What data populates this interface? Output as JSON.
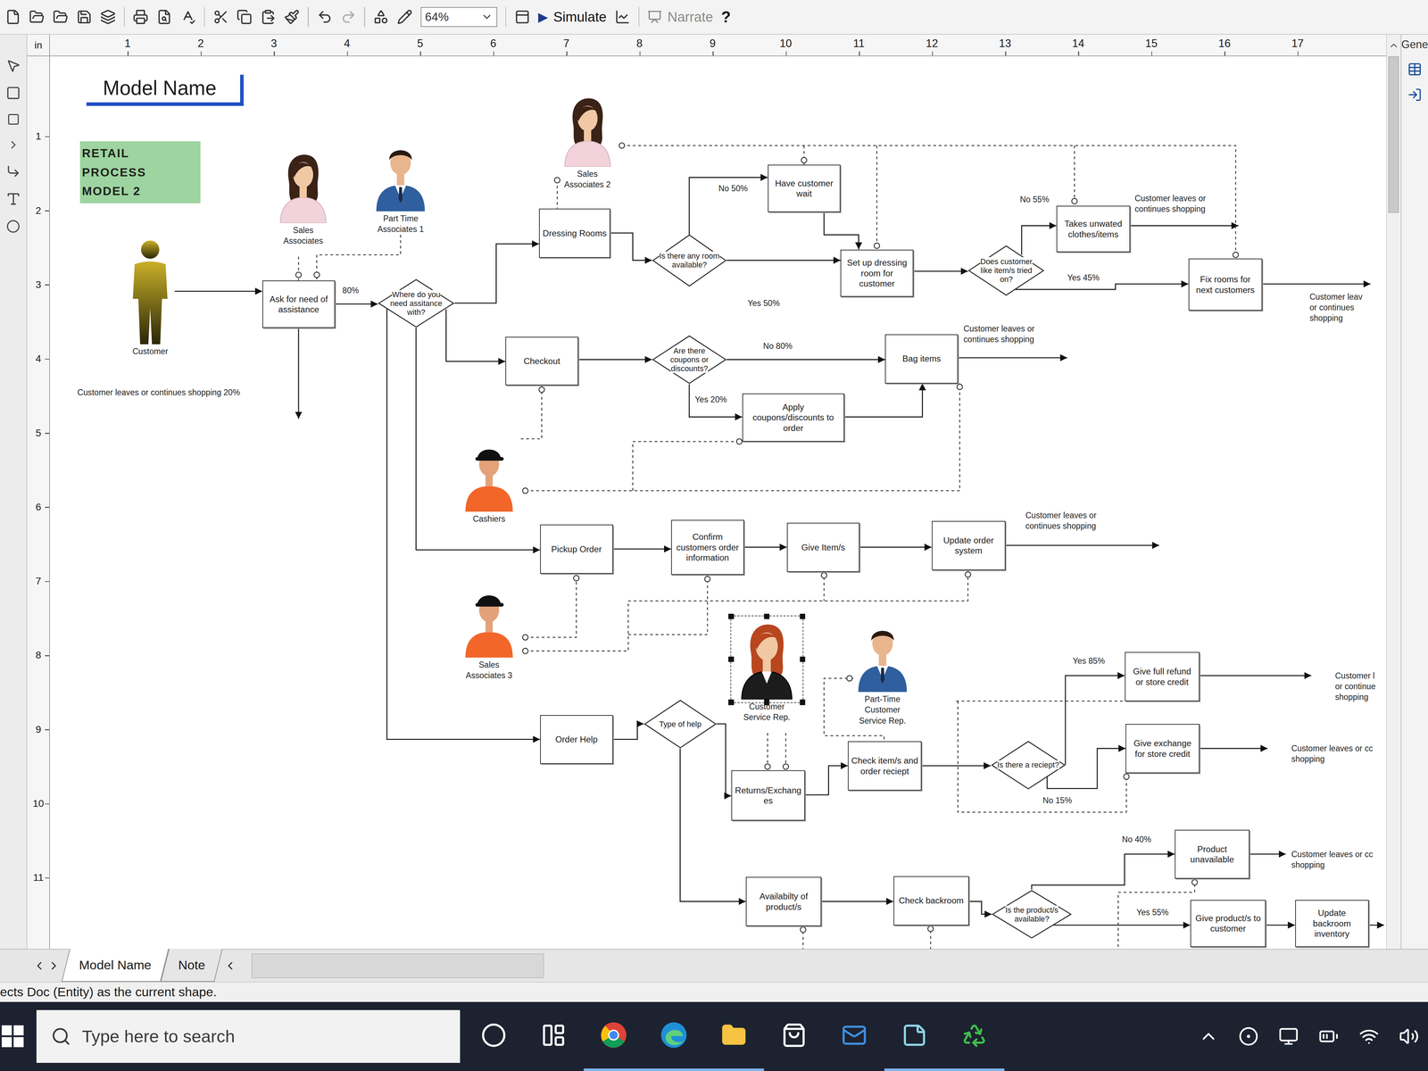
{
  "toolbar": {
    "zoom": "64%",
    "simulate": {
      "icon": "▶",
      "label": "Simulate"
    },
    "narrate": {
      "label": "Narrate",
      "disabled": true
    },
    "help": "?"
  },
  "ruler": {
    "unit": "in",
    "horizontal": [
      "1",
      "2",
      "3",
      "4",
      "5",
      "6",
      "7",
      "8",
      "9",
      "10",
      "11",
      "12",
      "13",
      "14",
      "15",
      "16",
      "17"
    ],
    "vertical": [
      "1",
      "2",
      "3",
      "4",
      "5",
      "6",
      "7",
      "8",
      "9",
      "10",
      "11"
    ]
  },
  "side_panel": {
    "title": "Gene"
  },
  "model": {
    "title": "Model Name",
    "label": [
      "RETAIL",
      "PROCESS",
      "MODEL 2"
    ]
  },
  "resources": [
    {
      "lines": [
        "Sales",
        "Associates"
      ],
      "kind": "woman",
      "color": "#f2d3dc",
      "selected": false
    },
    {
      "lines": [
        "Part Time",
        "Associates 1"
      ],
      "kind": "man",
      "color": "#2f5f9e",
      "selected": false
    },
    {
      "lines": [
        "Sales",
        "Associates 2"
      ],
      "kind": "woman",
      "color": "#f2d3dc",
      "selected": false
    },
    {
      "lines": [
        "Customer"
      ],
      "kind": "customer",
      "color": "#c9b028",
      "selected": false
    },
    {
      "lines": [
        "Cashiers"
      ],
      "kind": "worker",
      "color": "#f2662a",
      "selected": false
    },
    {
      "lines": [
        "Sales",
        "Associates 3"
      ],
      "kind": "worker",
      "color": "#f2662a",
      "selected": false
    },
    {
      "lines": [
        "Customer",
        "Service Rep."
      ],
      "kind": "agent",
      "color": "#1c1c1c",
      "selected": true
    },
    {
      "lines": [
        "Part-Time",
        "Customer",
        "Service Rep."
      ],
      "kind": "man",
      "color": "#2f5f9e",
      "selected": false
    }
  ],
  "activities": [
    {
      "label": "Ask for need of assistance"
    },
    {
      "label": "Dressing Rooms"
    },
    {
      "label": "Have customer wait"
    },
    {
      "label": "Set up dressing room for customer"
    },
    {
      "label": "Takes unwated clothes/items"
    },
    {
      "label": "Fix rooms for next customers"
    },
    {
      "label": "Checkout"
    },
    {
      "label": "Bag items"
    },
    {
      "label": "Apply coupons/discounts to order"
    },
    {
      "label": "Pickup Order"
    },
    {
      "label": "Confirm customers order information"
    },
    {
      "label": "Give Item/s"
    },
    {
      "label": "Update order system"
    },
    {
      "label": "Order Help"
    },
    {
      "label": "Returns/Exchanges"
    },
    {
      "label": "Check item/s and order reciept"
    },
    {
      "label": "Give full refund or store credit"
    },
    {
      "label": "Give exchange for store credit"
    },
    {
      "label": "Availabilty of product/s"
    },
    {
      "label": "Check backroom"
    },
    {
      "label": "Product unavailable"
    },
    {
      "label": "Give product/s to customer"
    },
    {
      "label": "Update backroom inventory"
    }
  ],
  "decisions": [
    {
      "label": "Where do you need assitance with?"
    },
    {
      "label": "Is there any room available?"
    },
    {
      "label": "Does customer like item/s tried on?"
    },
    {
      "label": "Are there coupons or discounts?"
    },
    {
      "label": "Type of help"
    },
    {
      "label": "Is there a reciept?"
    },
    {
      "label": "Is the product/s available?"
    }
  ],
  "notes": [
    {
      "lines": [
        "80%"
      ]
    },
    {
      "lines": [
        "Customer leaves or continues shopping 20%"
      ]
    },
    {
      "lines": [
        "No 50%"
      ]
    },
    {
      "lines": [
        "Yes 50%"
      ]
    },
    {
      "lines": [
        "No 55%"
      ]
    },
    {
      "lines": [
        "Customer leaves or",
        "continues shopping"
      ]
    },
    {
      "lines": [
        "Yes 45%"
      ]
    },
    {
      "lines": [
        "Customer leav",
        "or continues",
        "shopping"
      ]
    },
    {
      "lines": [
        "Customer leaves or",
        "continues shopping"
      ]
    },
    {
      "lines": [
        "No 80%"
      ]
    },
    {
      "lines": [
        "Yes 20%"
      ]
    },
    {
      "lines": [
        "Customer leaves or",
        "continues shopping"
      ]
    },
    {
      "lines": [
        "Yes 85%"
      ]
    },
    {
      "lines": [
        "No 15%"
      ]
    },
    {
      "lines": [
        "Customer l",
        "or continue",
        "shopping"
      ]
    },
    {
      "lines": [
        "Customer leaves or cc",
        "shopping"
      ]
    },
    {
      "lines": [
        "No 40%"
      ]
    },
    {
      "lines": [
        "Customer leaves or cc",
        "shopping"
      ]
    },
    {
      "lines": [
        "Yes 55%"
      ]
    }
  ],
  "sheet_tabs": [
    {
      "label": "Model Name",
      "selected": true
    },
    {
      "label": "Note",
      "selected": false
    }
  ],
  "status_bar": "ects Doc (Entity) as the current shape.",
  "taskbar": {
    "search": "Type here to search",
    "apps": [
      {
        "kind": "cortana",
        "running": false
      },
      {
        "kind": "taskview",
        "running": false
      },
      {
        "kind": "chrome",
        "running": true
      },
      {
        "kind": "edge",
        "running": true
      },
      {
        "kind": "explorer",
        "running": true
      },
      {
        "kind": "store",
        "running": false
      },
      {
        "kind": "mail",
        "running": false
      },
      {
        "kind": "notes",
        "running": true
      },
      {
        "kind": "process",
        "running": true
      }
    ]
  }
}
